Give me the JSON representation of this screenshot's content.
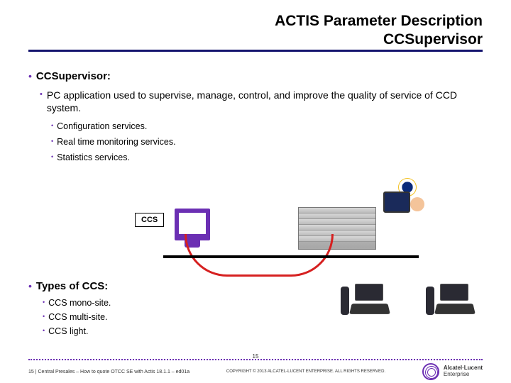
{
  "header": {
    "title_line1": "ACTIS Parameter Description",
    "title_line2": "CCSupervisor"
  },
  "section1": {
    "heading": "CCSupervisor:",
    "description": "PC application used to supervise, manage, control, and improve the quality of service of CCD system.",
    "items": [
      "Configuration services.",
      "Real time monitoring services.",
      "Statistics services."
    ]
  },
  "diagram": {
    "ccs_label": "CCS"
  },
  "section2": {
    "heading": "Types of CCS:",
    "items": [
      "CCS mono-site.",
      "CCS multi-site.",
      "CCS light."
    ]
  },
  "footer": {
    "page_number": "15",
    "left_text": "15 | Central Presales – How to quote OTCC SE with Actis 18.1.1 – ed01a",
    "copyright": "COPYRIGHT © 2013 ALCATEL-LUCENT ENTERPRISE.  ALL RIGHTS RESERVED.",
    "logo_brand": "Alcatel·Lucent",
    "logo_sub": "Enterprise"
  }
}
